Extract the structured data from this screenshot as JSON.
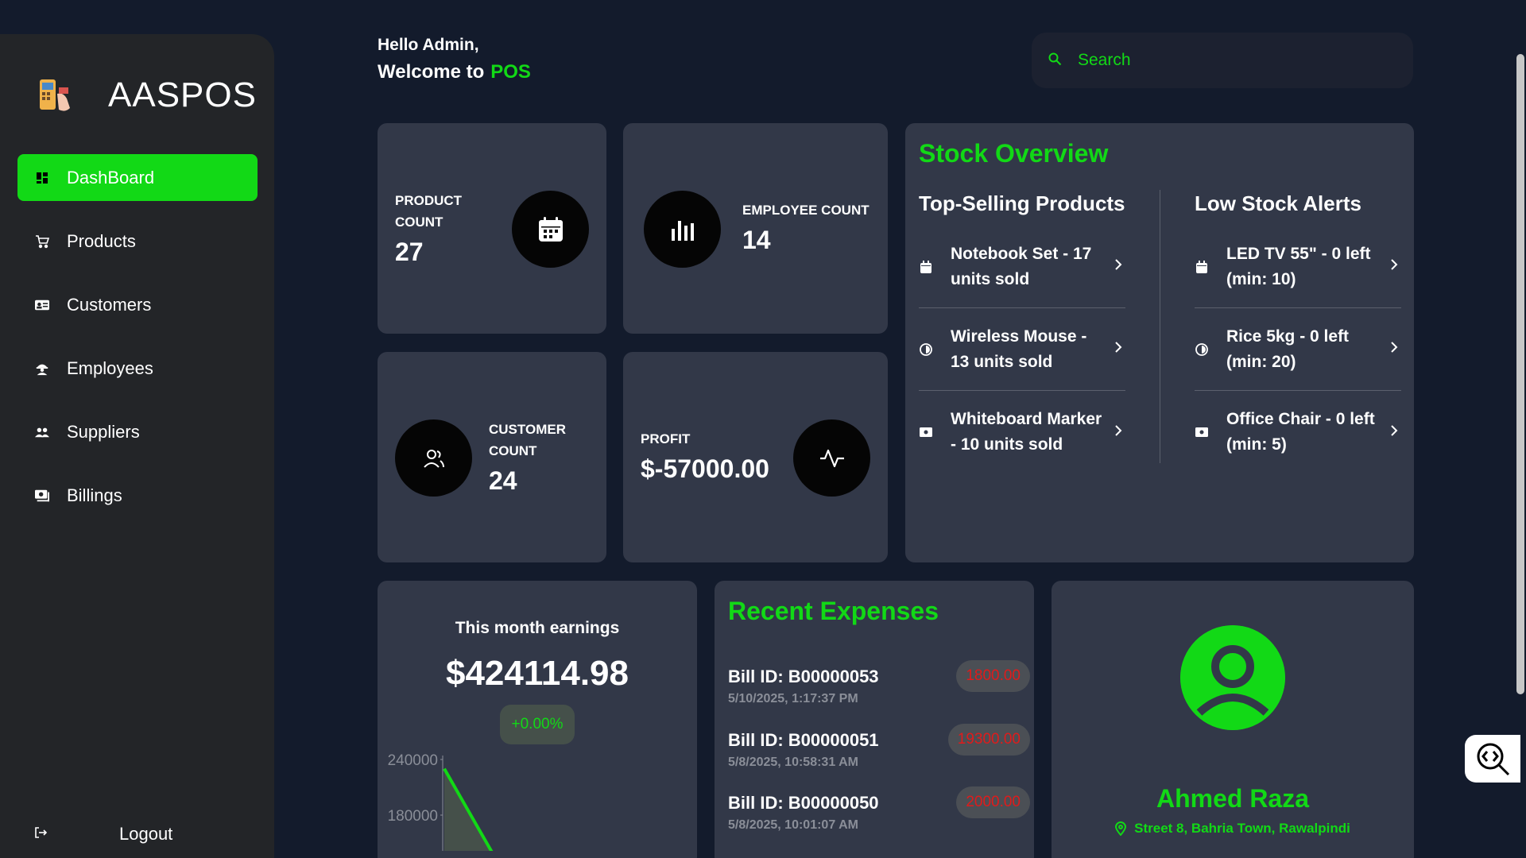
{
  "app": {
    "name": "AASPOS"
  },
  "sidebar": {
    "items": [
      {
        "label": "DashBoard",
        "icon": "dashboard-icon",
        "active": true
      },
      {
        "label": "Products",
        "icon": "cart-icon"
      },
      {
        "label": "Customers",
        "icon": "id-card-icon"
      },
      {
        "label": "Employees",
        "icon": "engineering-icon"
      },
      {
        "label": "Suppliers",
        "icon": "group-icon"
      },
      {
        "label": "Billings",
        "icon": "money-icon"
      }
    ],
    "logout_label": "Logout"
  },
  "header": {
    "greeting": "Hello Admin,",
    "welcome": "Welcome to",
    "welcome_accent": "POS"
  },
  "search": {
    "placeholder": "Search"
  },
  "stats": {
    "product": {
      "title": "PRODUCT COUNT",
      "value": "27"
    },
    "employee": {
      "title": "EMPLOYEE COUNT",
      "value": "14"
    },
    "customer": {
      "title": "CUSTOMER COUNT",
      "value": "24"
    },
    "profit": {
      "title": "PROFIT",
      "value": "$-57000.00"
    }
  },
  "stock": {
    "title": "Stock Overview",
    "top_selling_title": "Top-Selling Products",
    "low_stock_title": "Low Stock Alerts",
    "top_selling": [
      "Notebook Set - 17 units sold",
      "Wireless Mouse - 13 units sold",
      "Whiteboard Marker - 10 units sold"
    ],
    "low_stock": [
      "LED TV 55\" - 0 left (min: 10)",
      "Rice 5kg - 0 left (min: 20)",
      "Office Chair - 0 left (min: 5)"
    ]
  },
  "earnings": {
    "title": "This month earnings",
    "value": "$424114.98",
    "change": "+0.00%"
  },
  "chart_data": {
    "type": "area",
    "y_ticks": [
      "240000",
      "180000"
    ],
    "series": [
      {
        "values": [
          230000,
          140000
        ]
      }
    ]
  },
  "expenses": {
    "title": "Recent Expenses",
    "items": [
      {
        "bill": "Bill ID: B00000053",
        "date": "5/10/2025, 1:17:37 PM",
        "amount": "1800.00"
      },
      {
        "bill": "Bill ID: B00000051",
        "date": "5/8/2025, 10:58:31 AM",
        "amount": "19300.00"
      },
      {
        "bill": "Bill ID: B00000050",
        "date": "5/8/2025, 10:01:07 AM",
        "amount": "2000.00"
      }
    ]
  },
  "profile": {
    "name": "Ahmed Raza",
    "address": "Street 8, Bahria Town, Rawalpindi"
  },
  "colors": {
    "accent": "#12d916",
    "card": "#323848",
    "background": "#131b2c",
    "sidebar": "#232528",
    "danger": "#e01b1b"
  }
}
